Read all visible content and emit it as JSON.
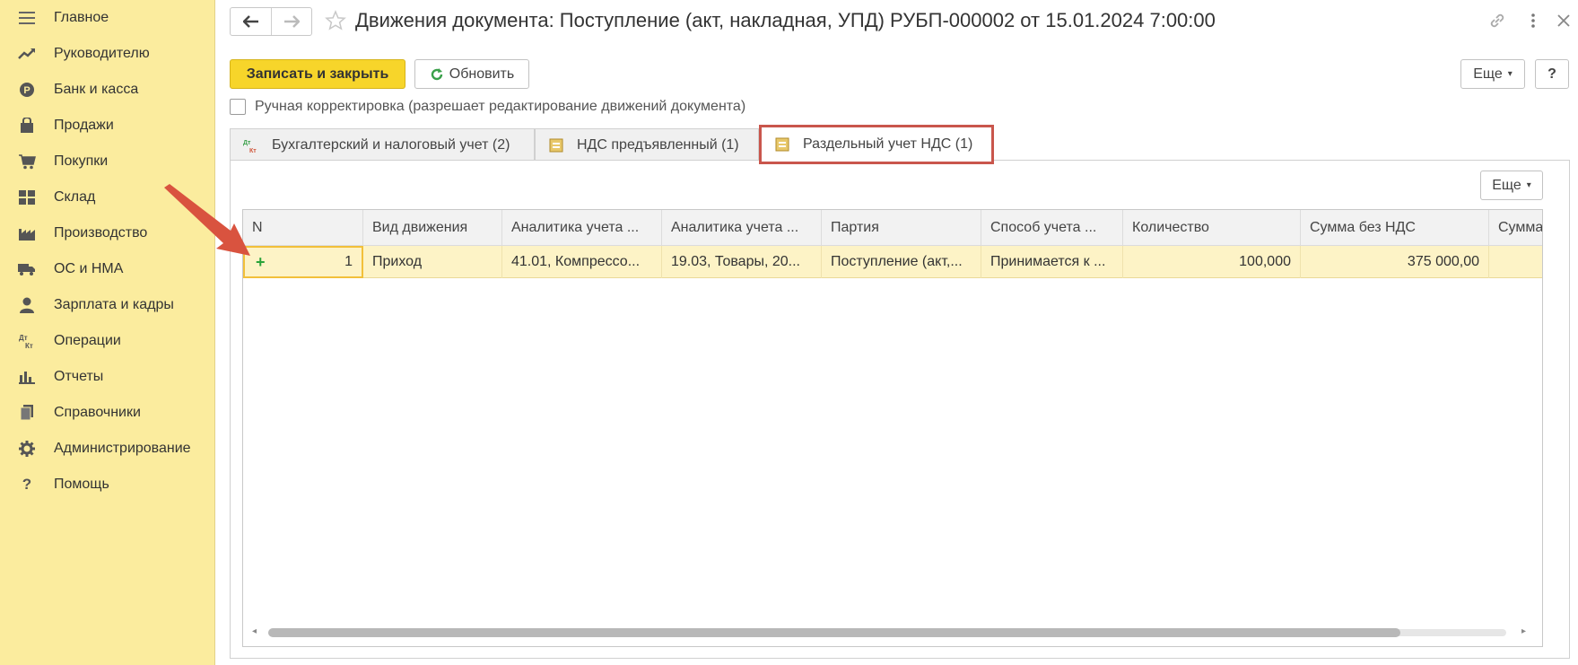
{
  "sidebar": {
    "items": [
      {
        "label": "Главное",
        "icon": "menu-icon"
      },
      {
        "label": "Руководителю",
        "icon": "trend-icon"
      },
      {
        "label": "Банк и касса",
        "icon": "coin-icon"
      },
      {
        "label": "Продажи",
        "icon": "bag-icon"
      },
      {
        "label": "Покупки",
        "icon": "cart-icon"
      },
      {
        "label": "Склад",
        "icon": "warehouse-icon"
      },
      {
        "label": "Производство",
        "icon": "factory-icon"
      },
      {
        "label": "ОС и НМА",
        "icon": "truck-icon"
      },
      {
        "label": "Зарплата и кадры",
        "icon": "person-icon"
      },
      {
        "label": "Операции",
        "icon": "dt-kt-icon"
      },
      {
        "label": "Отчеты",
        "icon": "bar-chart-icon"
      },
      {
        "label": "Справочники",
        "icon": "books-icon"
      },
      {
        "label": "Администрирование",
        "icon": "gear-icon"
      },
      {
        "label": "Помощь",
        "icon": "help-icon"
      }
    ]
  },
  "header": {
    "title": "Движения документа: Поступление (акт, накладная, УПД) РУБП-000002 от 15.01.2024 7:00:00"
  },
  "toolbar": {
    "save_close_label": "Записать и закрыть",
    "refresh_label": "Обновить",
    "more_label": "Еще",
    "help_label": "?"
  },
  "manual_edit": {
    "label": "Ручная корректировка (разрешает редактирование движений документа)"
  },
  "tabs": [
    {
      "label": "Бухгалтерский и налоговый учет (2)",
      "icon_text": "Дт Кт"
    },
    {
      "label": "НДС предъявленный (1)"
    },
    {
      "label": "Раздельный учет НДС (1)"
    }
  ],
  "table": {
    "more_label": "Еще",
    "columns": [
      "N",
      "Вид движения",
      "Аналитика учета ...",
      "Аналитика учета ...",
      "Партия",
      "Способ учета ...",
      "Количество",
      "Сумма без НДС",
      "Сумма"
    ],
    "rows": [
      {
        "n": "1",
        "movement": "Приход",
        "analytics1": "41.01, Компрессо...",
        "analytics2": "19.03, Товары, 20...",
        "batch": "Поступление (акт,...",
        "method": "Принимается к ...",
        "quantity": "100,000",
        "sum_no_vat": "375 000,00",
        "sum": ""
      }
    ]
  },
  "colors": {
    "sidebar_bg": "#fbec9e",
    "primary_button": "#f7d52a",
    "row_selected": "#fdf3c6",
    "highlight_border": "#c9564c"
  }
}
